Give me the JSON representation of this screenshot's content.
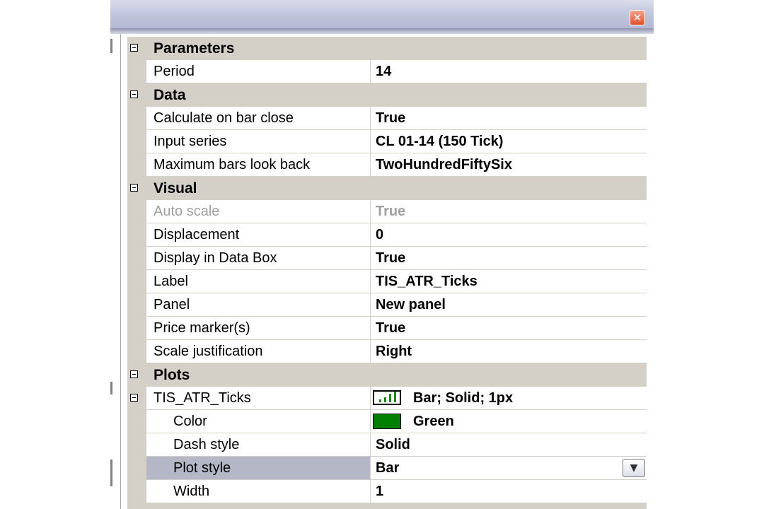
{
  "window": {
    "close_glyph": "✕"
  },
  "categories": {
    "parameters": "Parameters",
    "data": "Data",
    "visual": "Visual",
    "plots": "Plots"
  },
  "rows": {
    "period": {
      "name": "Period",
      "value": "14"
    },
    "calculate_on_close": {
      "name": "Calculate on bar close",
      "value": "True"
    },
    "input_series": {
      "name": "Input series",
      "value": "CL 01-14 (150 Tick)"
    },
    "max_bars_look_back": {
      "name": "Maximum bars look back",
      "value": "TwoHundredFiftySix"
    },
    "auto_scale": {
      "name": "Auto scale",
      "value": "True"
    },
    "displacement": {
      "name": "Displacement",
      "value": "0"
    },
    "display_in_data_box": {
      "name": "Display in Data Box",
      "value": "True"
    },
    "label": {
      "name": "Label",
      "value": "TIS_ATR_Ticks"
    },
    "panel": {
      "name": "Panel",
      "value": "New panel"
    },
    "price_markers": {
      "name": "Price marker(s)",
      "value": "True"
    },
    "scale_justification": {
      "name": "Scale justification",
      "value": "Right"
    },
    "plot_tis_atr": {
      "name": "TIS_ATR_Ticks",
      "value": "Bar; Solid; 1px"
    },
    "color": {
      "name": "Color",
      "value": "Green"
    },
    "dash_style": {
      "name": "Dash style",
      "value": "Solid"
    },
    "plot_style": {
      "name": "Plot style",
      "value": "Bar"
    },
    "width": {
      "name": "Width",
      "value": "1"
    }
  },
  "colors": {
    "plot_color": "#008000",
    "selected_row": "#b5b7c6",
    "category_bg": "#d4d0c8"
  },
  "icons": {
    "dropdown": "chevron-down-icon",
    "plot_preview": "bar-chart-icon",
    "expand": "collapse-box-icon"
  }
}
